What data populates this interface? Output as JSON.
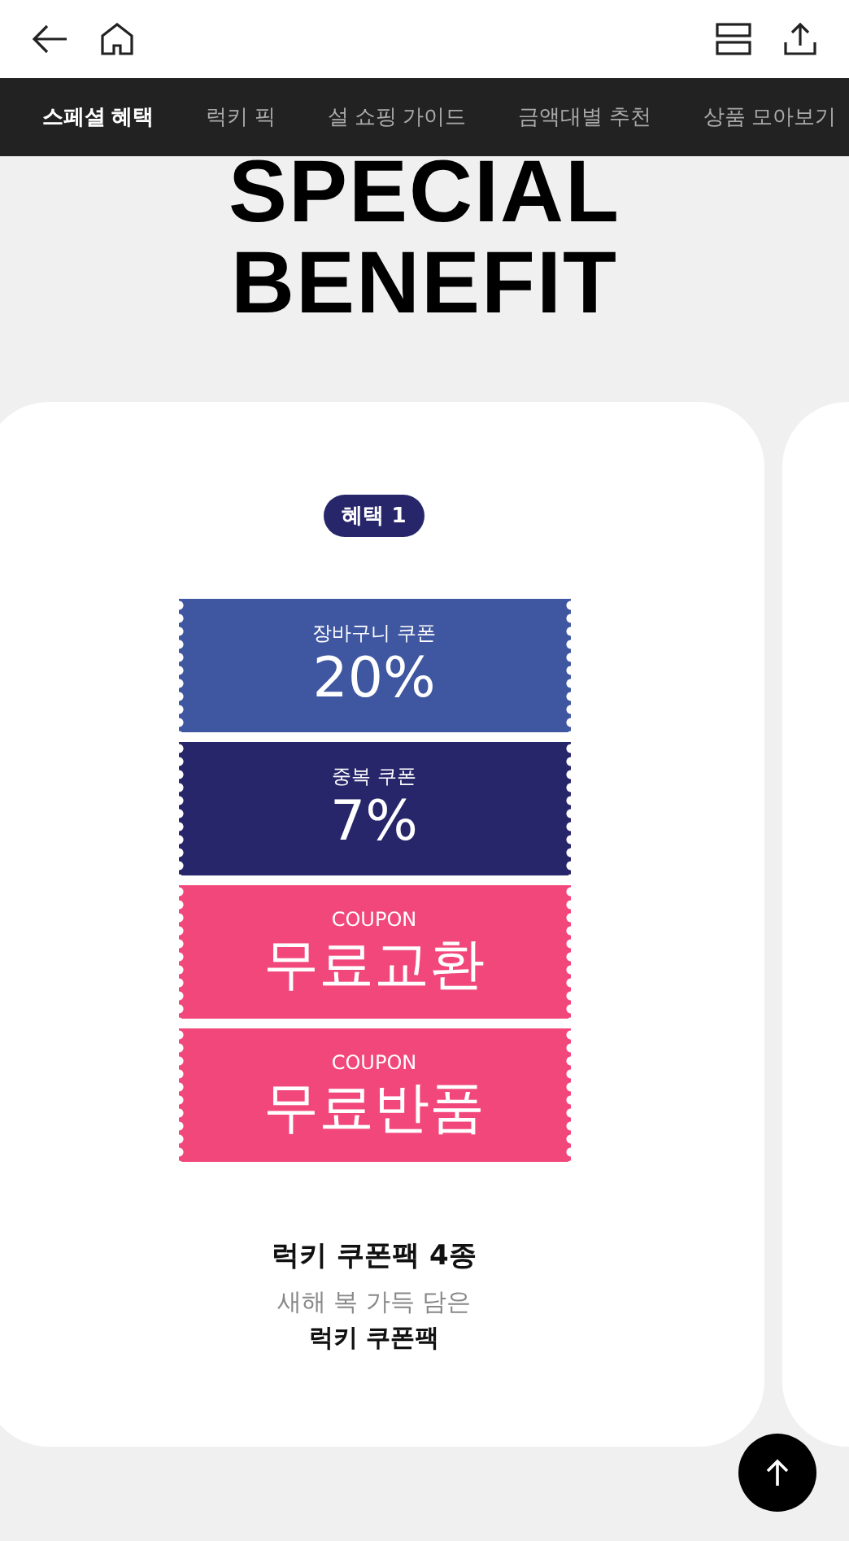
{
  "nav_tabs": [
    {
      "label": "스페셜 혜택",
      "selected": true
    },
    {
      "label": "럭키 픽",
      "selected": false
    },
    {
      "label": "설 쇼핑 가이드",
      "selected": false
    },
    {
      "label": "금액대별 추천",
      "selected": false
    },
    {
      "label": "상품 모아보기",
      "selected": false
    }
  ],
  "heading": [
    "SPECIAL",
    "BENEFIT"
  ],
  "card": {
    "badge": "혜택 1",
    "coupons": [
      {
        "caption": "장바구니 쿠폰",
        "value": "20%",
        "color": "#3f56a0"
      },
      {
        "caption": "중복 쿠폰",
        "value": "7%",
        "color": "#27266b"
      },
      {
        "caption": "COUPON",
        "value": "무료교환",
        "color": "#f2477a"
      },
      {
        "caption": "COUPON",
        "value": "무료반품",
        "color": "#f2477a"
      }
    ],
    "title": "럭키 쿠폰팩 4종",
    "subtitle": "새해 복 가득 담은",
    "subtitle_bold": "럭키 쿠폰팩"
  }
}
